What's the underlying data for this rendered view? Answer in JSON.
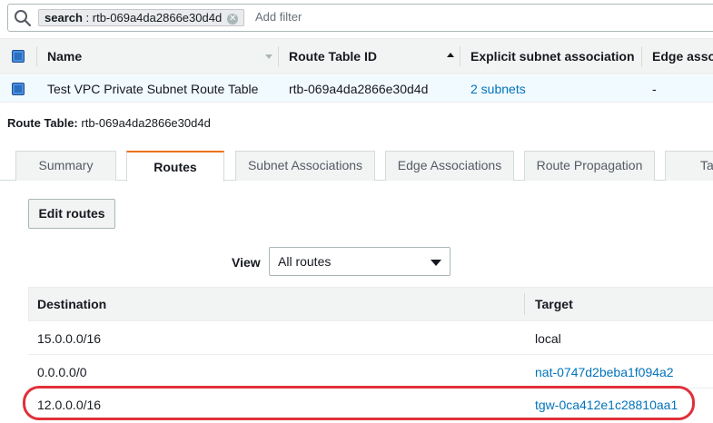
{
  "search": {
    "token_key": "search",
    "token_value": "rtb-069a4da2866e30d4d",
    "add_filter_placeholder": "Add filter"
  },
  "grid": {
    "columns": [
      "Name",
      "Route Table ID",
      "Explicit subnet association",
      "Edge asso"
    ],
    "rows": [
      {
        "name": "Test VPC Private Subnet Route Table",
        "route_table_id": "rtb-069a4da2866e30d4d",
        "explicit_subnet": "2 subnets",
        "edge": "-"
      }
    ]
  },
  "details": {
    "label": "Route Table:",
    "value": "rtb-069a4da2866e30d4d"
  },
  "tabs": [
    "Summary",
    "Routes",
    "Subnet Associations",
    "Edge Associations",
    "Route Propagation",
    "Ta"
  ],
  "active_tab": "Routes",
  "routes": {
    "edit_button": "Edit routes",
    "view_label": "View",
    "view_selected": "All routes",
    "columns": [
      "Destination",
      "Target"
    ],
    "rows": [
      {
        "destination": "15.0.0.0/16",
        "target": "local"
      },
      {
        "destination": "0.0.0.0/0",
        "target": "nat-0747d2beba1f094a2"
      },
      {
        "destination": "12.0.0.0/16",
        "target": "tgw-0ca412e1c28810aa1"
      }
    ]
  },
  "colors": {
    "accent": "#ec7211",
    "link": "#0073bb",
    "highlight": "#e0303a",
    "selection": "#2b6fc0"
  }
}
